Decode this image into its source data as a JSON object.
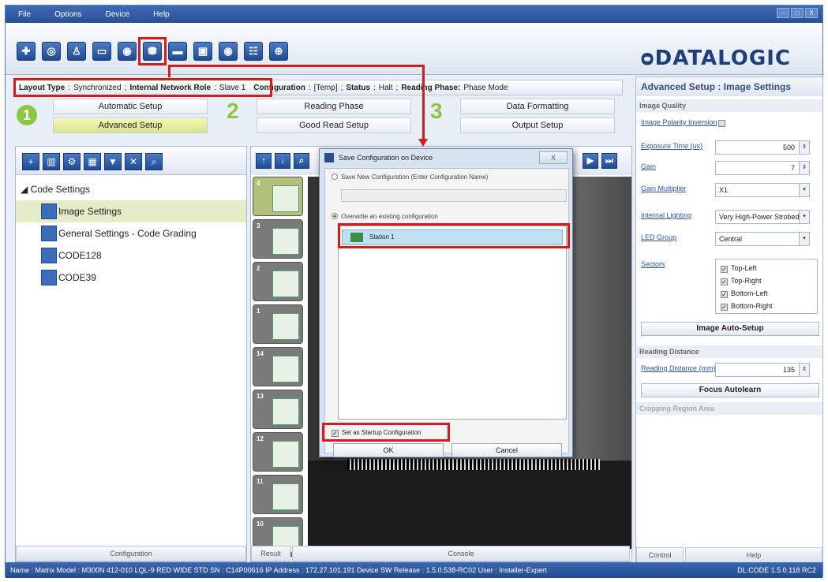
{
  "menu": {
    "items": [
      "File",
      "Options",
      "Device",
      "Help"
    ]
  },
  "window_controls": [
    "–",
    "□",
    "X"
  ],
  "toolbar": {
    "icons": [
      "cross-icon",
      "target-icon",
      "user-icon",
      "window-icon",
      "camera-icon",
      "save-icon",
      "tag-icon",
      "monitor-icon",
      "camera2-icon",
      "config-icon",
      "crosshair-icon"
    ],
    "glyphs": [
      "✚",
      "◎",
      "♙",
      "▭",
      "◉",
      "⛃",
      "▬",
      "▣",
      "◉",
      "☷",
      "⊕"
    ]
  },
  "logo": "ᴑDATALOGIC",
  "info": {
    "layout_label": "Layout Type",
    "layout_value": "Synchronized",
    "role_label": "Internal Network Role",
    "role_value": "Slave 1",
    "config_label": "Configuration",
    "config_value": "[Temp]",
    "status_label": "Status",
    "status_value": "Halt",
    "phase_label": "Reading Phase:",
    "phase_value": "Phase Mode"
  },
  "steps": {
    "one": "1",
    "two": "2",
    "three": "3",
    "automatic": "Automatic Setup",
    "advanced": "Advanced Setup",
    "reading_phase": "Reading Phase",
    "good_read": "Good Read Setup",
    "data_formatting": "Data Formatting",
    "output_setup": "Output Setup"
  },
  "tree": {
    "root": "◢ Code Settings",
    "items": [
      {
        "label": "Image Settings"
      },
      {
        "label": "General Settings - Code Grading"
      },
      {
        "label": "CODE128"
      },
      {
        "label": "CODE39"
      }
    ]
  },
  "tabs": {
    "configuration": "Configuration",
    "result": "Result",
    "console": "Console",
    "control": "Control",
    "help": "Help"
  },
  "thumbs": [
    "4",
    "3",
    "2",
    "1",
    "14",
    "13",
    "12",
    "11",
    "10"
  ],
  "dialog": {
    "title": "Save Configuration on Device",
    "close": "X",
    "option_new": "Save New Configuration (Enter Configuration Name)",
    "option_overwrite": "Overwrite an existing configuration",
    "station": "Station 1",
    "startup": "Set as Startup Configuration",
    "ok": "OK",
    "cancel": "Cancel"
  },
  "right": {
    "title": "Advanced Setup :  Image Settings",
    "section_quality": "Image Quality",
    "polarity": "Image Polarity Inversion",
    "exposure_label": "Exposure Time (us)",
    "exposure": "500",
    "gain_label": "Gain",
    "gain": "7",
    "gainmult_label": "Gain Multiplier",
    "gainmult": "X1",
    "lighting_label": "Internal Lighting",
    "lighting": "Very High-Power Strobed",
    "led_label": "LED Group",
    "led": "Central",
    "sectors_label": "Sectors",
    "sectors": [
      "Top-Left",
      "Top-Right",
      "Bottom-Left",
      "Bottom-Right"
    ],
    "auto_setup": "Image Auto-Setup",
    "section_distance": "Reading Distance",
    "distance_label": "Reading Distance (mm)",
    "distance": "135",
    "focus": "Focus Autolearn",
    "section_crop": "Cropping Region Area"
  },
  "status": {
    "text": "Name : Matrix   Model : M300N 412-010 LQL-9 RED WIDE STD   SN : C14P00616   IP Address : 172.27.101.191   Device SW Release : 1.5.0.538-RC02   User : Installer-Expert",
    "version": "DL.CODE 1.5.0.118 RC2"
  }
}
